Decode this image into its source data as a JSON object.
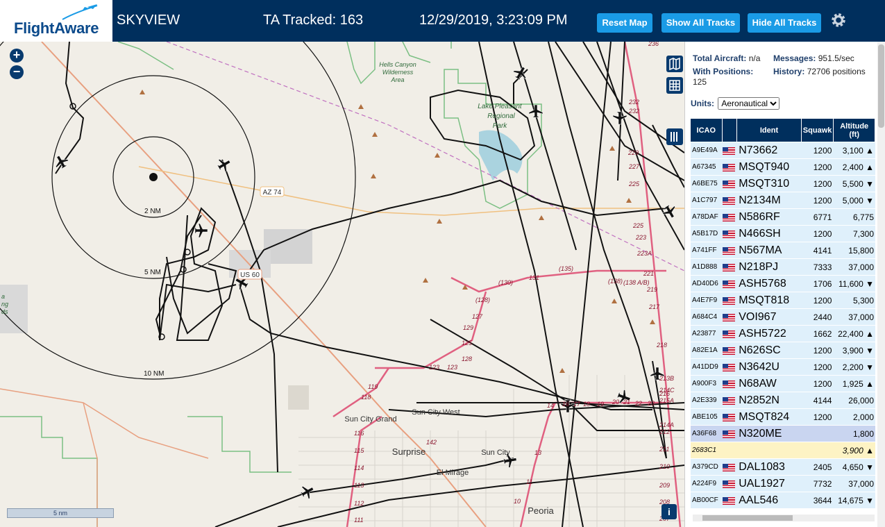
{
  "app": {
    "logo_text": "FlightAware",
    "brand": "SKYVIEW",
    "tracked": "TA Tracked: 163",
    "datetime": "12/29/2019, 3:23:09 PM",
    "buttons": {
      "reset": "Reset Map",
      "show_all": "Show All Tracks",
      "hide_all": "Hide All Tracks"
    }
  },
  "map": {
    "zoom_in": "+",
    "zoom_out": "−",
    "scale": "5 nm",
    "info": "i",
    "range_rings": [
      "2 NM",
      "5 NM",
      "10 NM"
    ],
    "labels": {
      "hells_canyon": [
        "Hells Canyon",
        "Wilderness",
        "Area"
      ],
      "lake_pleasant": [
        "Lake Pleasant",
        "Regional",
        "Park"
      ],
      "az74": "AZ 74",
      "us60": "US 60",
      "sun_city_grand": "Sun City Grand",
      "sun_city_west": "Sun City West",
      "surprise": "Surprise",
      "sun_city": "Sun City",
      "el_mirage": "El Mirage",
      "peoria": "Peoria",
      "left_edge": [
        "a",
        "ng",
        "ds"
      ]
    },
    "exits": [
      "232",
      "232",
      "229",
      "227",
      "225",
      "225",
      "223",
      "223A",
      "221",
      "219",
      "217",
      "218",
      "(135)",
      "(130)",
      "131",
      "(128)",
      "127",
      "125",
      "123",
      "123",
      "(138)",
      "(138 A/B)",
      "129",
      "128",
      "119",
      "118",
      "116",
      "115",
      "114",
      "113",
      "112",
      "111",
      "10",
      "11",
      "13",
      "14",
      "16",
      "17",
      "18",
      "19",
      "20",
      "21",
      "22",
      "23",
      "142",
      "216",
      "215A",
      "214A",
      "214C",
      "213B",
      "212",
      "211",
      "210",
      "209",
      "208",
      "207",
      "236"
    ]
  },
  "panel": {
    "total_label": "Total Aircraft:",
    "total_value": "n/a",
    "messages_label": "Messages:",
    "messages_value": "951.5/sec",
    "positions_label": "With Positions:",
    "positions_value": "125",
    "history_label": "History:",
    "history_value": "72706 positions",
    "units_label": "Units:",
    "units_value": "Aeronautical",
    "headers": [
      "ICAO",
      "",
      "Ident",
      "Squawk",
      "Altitude (ft)"
    ],
    "rows": [
      {
        "icao": "A9E49A",
        "ident": "N73662",
        "squawk": "1200",
        "alt": "3,100 ▲"
      },
      {
        "icao": "A67345",
        "ident": "MSQT940",
        "squawk": "1200",
        "alt": "2,400 ▲"
      },
      {
        "icao": "A6BE75",
        "ident": "MSQT310",
        "squawk": "1200",
        "alt": "5,500 ▼"
      },
      {
        "icao": "A1C797",
        "ident": "N2134M",
        "squawk": "1200",
        "alt": "5,000 ▼"
      },
      {
        "icao": "A78DAF",
        "ident": "N586RF",
        "squawk": "6771",
        "alt": "6,775"
      },
      {
        "icao": "A5B17D",
        "ident": "N466SH",
        "squawk": "1200",
        "alt": "7,300"
      },
      {
        "icao": "A741FF",
        "ident": "N567MA",
        "squawk": "4141",
        "alt": "15,800"
      },
      {
        "icao": "A1D888",
        "ident": "N218PJ",
        "squawk": "7333",
        "alt": "37,000"
      },
      {
        "icao": "AD40D6",
        "ident": "ASH5768",
        "squawk": "1706",
        "alt": "11,600 ▼"
      },
      {
        "icao": "A4E7F9",
        "ident": "MSQT818",
        "squawk": "1200",
        "alt": "5,300"
      },
      {
        "icao": "A684C4",
        "ident": "VOI967",
        "squawk": "2440",
        "alt": "37,000"
      },
      {
        "icao": "A23877",
        "ident": "ASH5722",
        "squawk": "1662",
        "alt": "22,400 ▲"
      },
      {
        "icao": "A82E1A",
        "ident": "N626SC",
        "squawk": "1200",
        "alt": "3,900 ▼"
      },
      {
        "icao": "A41DD9",
        "ident": "N3642U",
        "squawk": "1200",
        "alt": "2,200 ▼"
      },
      {
        "icao": "A900F3",
        "ident": "N68AW",
        "squawk": "1200",
        "alt": "1,925 ▲"
      },
      {
        "icao": "A2E339",
        "ident": "N2852N",
        "squawk": "4144",
        "alt": "26,000"
      },
      {
        "icao": "ABE105",
        "ident": "MSQT824",
        "squawk": "1200",
        "alt": "2,000"
      },
      {
        "icao": "A36F68",
        "ident": "N320ME",
        "squawk": "",
        "alt": "1,800"
      },
      {
        "icao": "2683C1",
        "ident": "",
        "squawk": "",
        "alt": "3,900 ▲"
      },
      {
        "icao": "A379CD",
        "ident": "DAL1083",
        "squawk": "2405",
        "alt": "4,650 ▼"
      },
      {
        "icao": "A224F9",
        "ident": "UAL1927",
        "squawk": "7732",
        "alt": "37,000"
      },
      {
        "icao": "AB00CF",
        "ident": "AAL546",
        "squawk": "3644",
        "alt": "14,675 ▼"
      }
    ]
  },
  "colors": {
    "header_bg": "#002f5d",
    "button_bg": "#1a9be6",
    "row_bg": "#dff0fb",
    "selected_row": "#c9d5f0",
    "noflag_row": "#fdf3c4"
  }
}
